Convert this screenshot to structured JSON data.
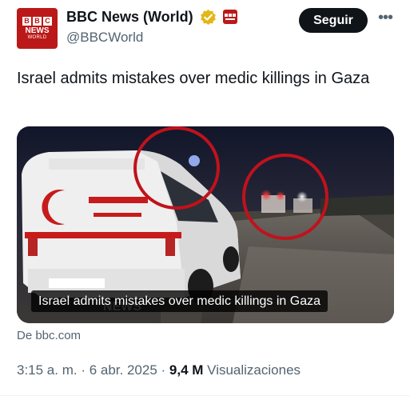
{
  "account": {
    "display_name": "BBC News (World)",
    "handle": "@BBCWorld",
    "avatar_line2": "NEWS",
    "avatar_line3": "WORLD",
    "avatar_letters": [
      "B",
      "B",
      "C"
    ]
  },
  "actions": {
    "follow_label": "Seguir",
    "more_label": "•••"
  },
  "tweet": {
    "text": "Israel admits mistakes over medic killings in Gaza",
    "media_caption": "Israel admits mistakes over medic killings in Gaza",
    "source": "De bbc.com"
  },
  "meta": {
    "time": "3:15 a. m.",
    "sep1": " · ",
    "date": "6 abr. 2025",
    "sep2": " · ",
    "views_count": "9,4 M",
    "views_label": " Visualizaciones"
  },
  "colors": {
    "brand_red": "#bb1919",
    "verified_gold": "#e2b719",
    "text_primary": "#0f1419",
    "text_secondary": "#536471",
    "circle_red": "#c0121c"
  },
  "icons": {
    "verified": "verified-badge-icon",
    "affiliate": "bbc-affiliate-icon",
    "more": "more-horizontal-icon"
  }
}
